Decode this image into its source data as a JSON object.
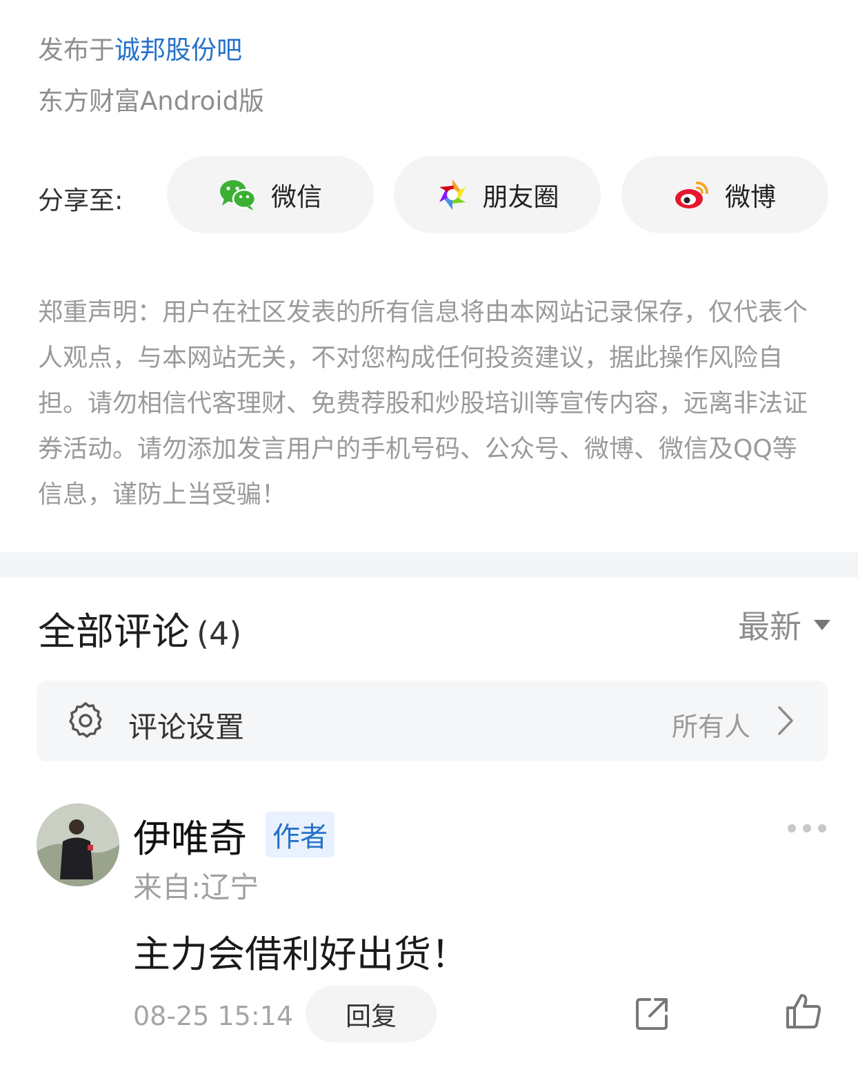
{
  "post": {
    "published_prefix": "发布于",
    "bar_name": "诚邦股份吧",
    "client": "东方财富Android版"
  },
  "share": {
    "label": "分享至:",
    "items": [
      {
        "label": "微信",
        "icon": "wechat-icon"
      },
      {
        "label": "朋友圈",
        "icon": "moments-icon"
      },
      {
        "label": "微博",
        "icon": "weibo-icon"
      }
    ]
  },
  "disclaimer": "郑重声明：用户在社区发表的所有信息将由本网站记录保存，仅代表个人观点，与本网站无关，不对您构成任何投资建议，据此操作风险自担。请勿相信代客理财、免费荐股和炒股培训等宣传内容，远离非法证券活动。请勿添加发言用户的手机号码、公众号、微博、微信及QQ等信息，谨防上当受骗！",
  "comments": {
    "title": "全部评论",
    "count": "(4)",
    "sort_label": "最新",
    "settings": {
      "title": "评论设置",
      "value": "所有人"
    },
    "items": [
      {
        "author": "伊唯奇",
        "badge": "作者",
        "location": "来自:辽宁",
        "text": "主力会借利好出货！",
        "time": "08-25 15:14",
        "reply_label": "回复"
      }
    ]
  },
  "colors": {
    "link": "#2672c9",
    "muted": "#9a9a9a",
    "wechat_green": "#3cb034",
    "weibo_red": "#e6162d"
  }
}
